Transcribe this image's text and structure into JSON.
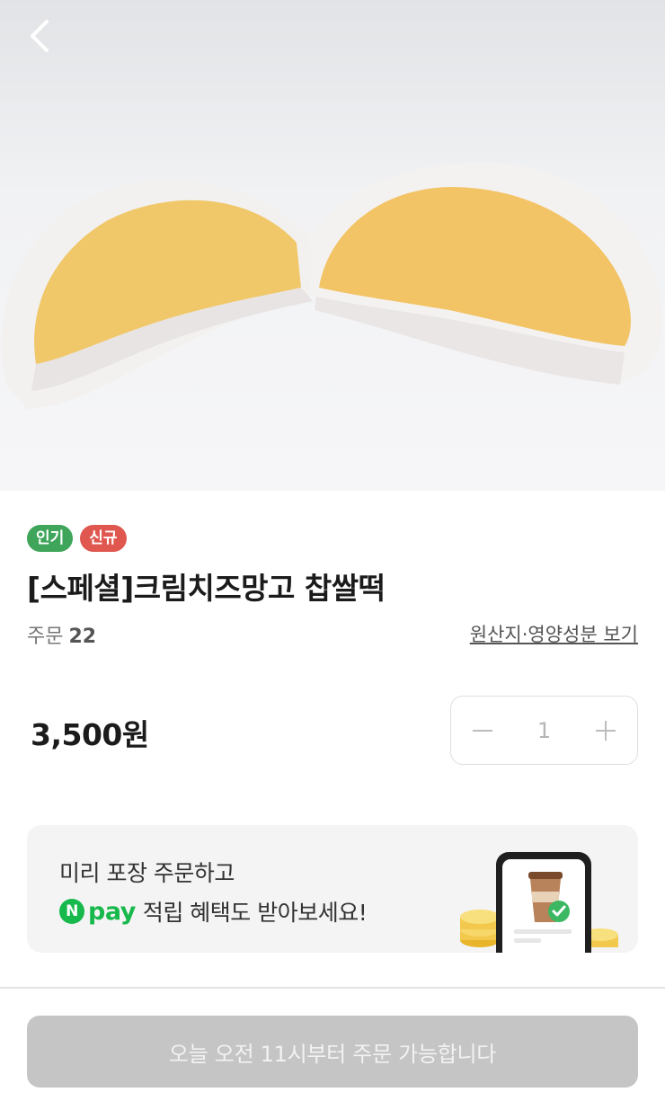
{
  "product": {
    "badges": {
      "popular": "인기",
      "new": "신규"
    },
    "title": "[스페셜]크림치즈망고 찹쌀떡",
    "order_label": "주문",
    "order_count": "22",
    "origin_link": "원산지·영양성분 보기",
    "price": "3,500원"
  },
  "quantity": {
    "value": "1"
  },
  "promo": {
    "line1": "미리 포장 주문하고",
    "npay_mark": "N",
    "npay_text": "pay",
    "line2": "적립 혜택도 받아보세요!"
  },
  "cta": {
    "label": "오늘 오전 11시부터 주문 가능합니다"
  },
  "colors": {
    "badge_popular": "#3ea55a",
    "badge_new": "#e0574f",
    "npay_green": "#18b94c",
    "cta_disabled": "#c5c5c5"
  },
  "icons": {
    "back": "chevron-left-icon",
    "minus": "minus-icon",
    "plus": "plus-icon"
  }
}
